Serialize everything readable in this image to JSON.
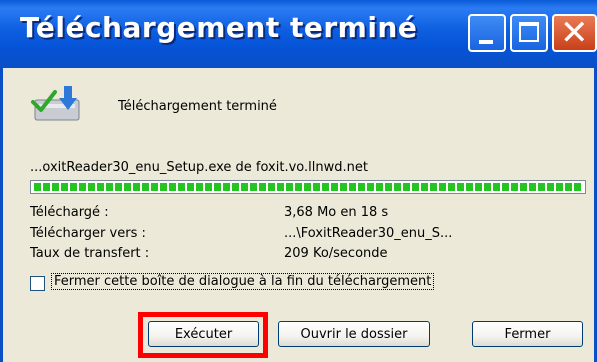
{
  "window": {
    "title": "Téléchargement terminé",
    "controls": {
      "minimize_icon": "minimize-icon",
      "maximize_icon": "maximize-icon",
      "close_glyph": "✕"
    }
  },
  "status": {
    "icon": "download-complete-icon",
    "text": "Téléchargement terminé"
  },
  "download": {
    "file_source": "...oxitReader30_enu_Setup.exe de foxit.vo.llnwd.net",
    "progress_percent": 100
  },
  "info": [
    {
      "label": "Téléchargé :",
      "value": "3,68 Mo en 18 s"
    },
    {
      "label": "Télécharger vers :",
      "value": "...\\FoxitReader30_enu_S..."
    },
    {
      "label": "Taux de transfert :",
      "value": "209 Ko/seconde"
    }
  ],
  "close_on_finish": {
    "checked": false,
    "label": "Fermer cette boîte de dialogue à la fin du téléchargement"
  },
  "buttons": {
    "execute": "Exécuter",
    "open_folder": "Ouvrir le dossier",
    "close": "Fermer"
  },
  "colors": {
    "titlebar": "#0653d6",
    "progress": "#25c521",
    "highlight": "#ff0000"
  }
}
